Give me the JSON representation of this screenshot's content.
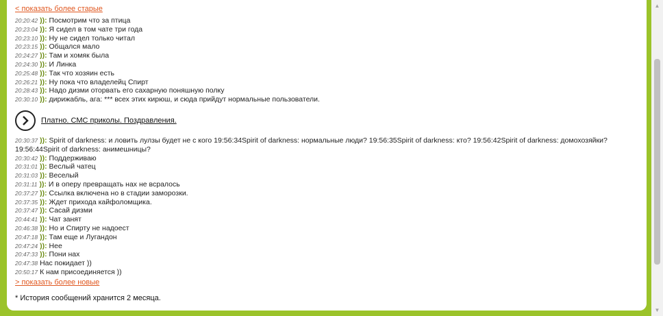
{
  "nav": {
    "older_label": "< показать более старые",
    "newer_label": "> показать более новые"
  },
  "messages_top": [
    {
      "time": "20:20:42",
      "nick": ")):",
      "text": "Посмотрим что за птица"
    },
    {
      "time": "20:23:04",
      "nick": ")):",
      "text": "Я сидел в том чате три года"
    },
    {
      "time": "20:23:10",
      "nick": ")):",
      "text": "Ну не сидел только читал"
    },
    {
      "time": "20:23:15",
      "nick": ")):",
      "text": "Общался мало"
    },
    {
      "time": "20:24:27",
      "nick": ")):",
      "text": "Там и хомяк была"
    },
    {
      "time": "20:24:30",
      "nick": ")):",
      "text": "И Линка"
    },
    {
      "time": "20:25:48",
      "nick": ")):",
      "text": "Так что хозяин есть"
    },
    {
      "time": "20:26:21",
      "nick": ")):",
      "text": "Ну пока что владелейц Спирт"
    },
    {
      "time": "20:28:43",
      "nick": ")):",
      "text": "Надо дизми оторвать его сахарную поняшную полку"
    },
    {
      "time": "20:30:10",
      "nick": ")):",
      "text": "дирижабль, ага: *** всех этих кирюш, и сюда прийдут нормальные пользователи."
    }
  ],
  "promo": {
    "icon": "chevron-right-circle-icon",
    "link_label": "Платно. СМС приколы. Поздравления."
  },
  "messages_bottom": [
    {
      "time": "20:30:37",
      "nick": ")):",
      "text": "Spirit of darkness: и ловить лулзы будет не с кого 19:56:34Spirit of darkness: нормальные люди? 19:56:35Spirit of darkness: кто? 19:56:42Spirit of darkness: домохозяйки? 19:56:44Spirit of darkness: анимешницы?"
    },
    {
      "time": "20:30:42",
      "nick": ")):",
      "text": "Поддерживаю"
    },
    {
      "time": "20:31:01",
      "nick": ")):",
      "text": "Веслый чатец"
    },
    {
      "time": "20:31:03",
      "nick": ")):",
      "text": "Веселый"
    },
    {
      "time": "20:31:11",
      "nick": ")):",
      "text": "И в оперу превращать нах не всралось"
    },
    {
      "time": "20:37:27",
      "nick": ")):",
      "text": "Ссылка включена но в стадии заморозки."
    },
    {
      "time": "20:37:35",
      "nick": ")):",
      "text": "Ждет прихода кайфоломщика."
    },
    {
      "time": "20:37:47",
      "nick": ")):",
      "text": "Сасай дизми"
    },
    {
      "time": "20:44:41",
      "nick": ")):",
      "text": "Чат занят"
    },
    {
      "time": "20:46:38",
      "nick": ")):",
      "text": "Но и Спирту не надоест"
    },
    {
      "time": "20:47:18",
      "nick": ")):",
      "text": "Там еще и Лугандон"
    },
    {
      "time": "20:47:24",
      "nick": ")):",
      "text": "Нее"
    },
    {
      "time": "20:47:33",
      "nick": ")):",
      "text": "Пони нах"
    },
    {
      "time": "20:47:38",
      "nick": "",
      "text": "Нас покидает ))"
    },
    {
      "time": "20:50:17",
      "nick": "",
      "text": "К нам присоединяется ))"
    }
  ],
  "footer_note": "* История сообщений хранится 2 месяца.",
  "colors": {
    "background": "#9bc32a",
    "link": "#e0571f",
    "nick": "#6a8a10"
  }
}
